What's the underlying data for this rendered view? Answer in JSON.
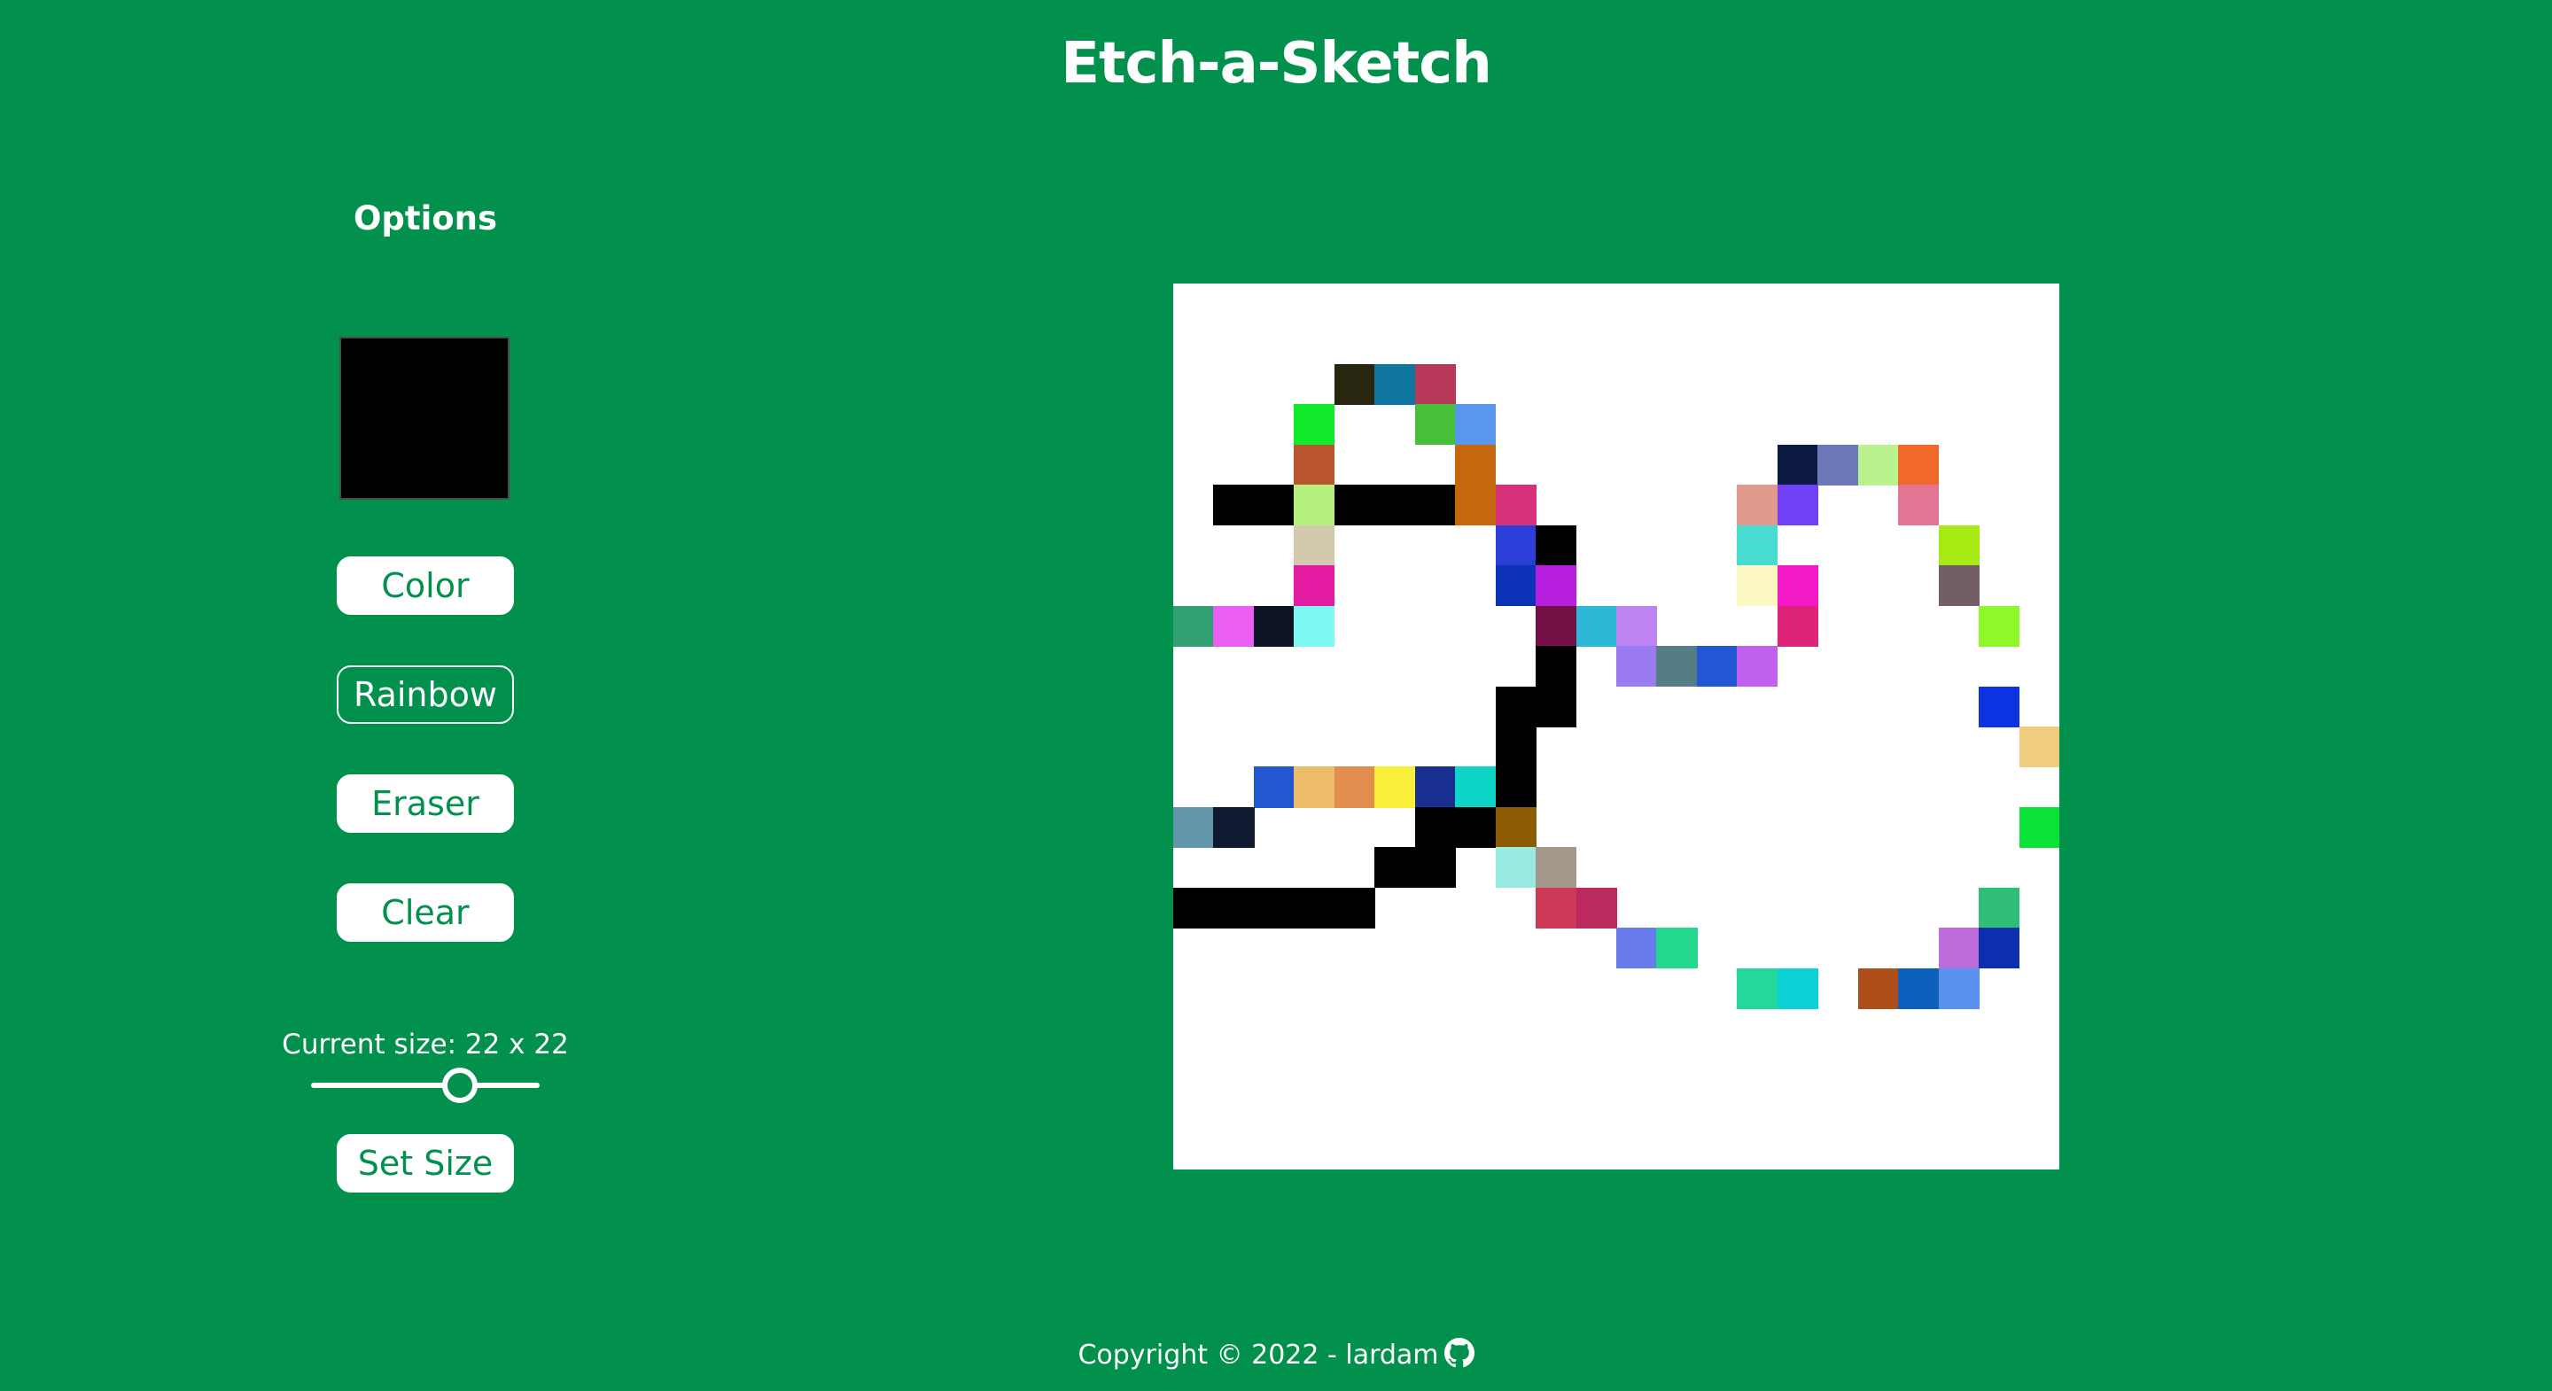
{
  "header": {
    "title": "Etch-a-Sketch"
  },
  "options": {
    "title": "Options",
    "current_color": "#000000",
    "buttons": {
      "color": "Color",
      "rainbow": "Rainbow",
      "eraser": "Eraser",
      "clear": "Clear",
      "set_size": "Set Size"
    },
    "active_mode": "rainbow",
    "size_label": "Current size: 22 x 22",
    "size": {
      "value": 22,
      "min": 1,
      "max": 32
    }
  },
  "grid": {
    "rows": 22,
    "cols": 22,
    "background": "#ffffff",
    "painted_cells": [
      [
        2,
        4,
        "#28260f"
      ],
      [
        2,
        5,
        "#0f779f"
      ],
      [
        2,
        6,
        "#b8385a"
      ],
      [
        3,
        3,
        "#10ea2b"
      ],
      [
        3,
        6,
        "#46c038"
      ],
      [
        3,
        7,
        "#5997ec"
      ],
      [
        4,
        3,
        "#b8552c"
      ],
      [
        4,
        7,
        "#c4670e"
      ],
      [
        4,
        15,
        "#0c1a42"
      ],
      [
        4,
        16,
        "#6d78b9"
      ],
      [
        4,
        17,
        "#b9f28e"
      ],
      [
        4,
        18,
        "#f1682b"
      ],
      [
        5,
        1,
        "#000000"
      ],
      [
        5,
        2,
        "#000000"
      ],
      [
        5,
        3,
        "#b5f07e"
      ],
      [
        5,
        4,
        "#000000"
      ],
      [
        5,
        5,
        "#000000"
      ],
      [
        5,
        6,
        "#000000"
      ],
      [
        5,
        7,
        "#c4670e"
      ],
      [
        5,
        8,
        "#d8317b"
      ],
      [
        5,
        14,
        "#e0998a"
      ],
      [
        5,
        15,
        "#7041f7"
      ],
      [
        5,
        18,
        "#e17593"
      ],
      [
        6,
        3,
        "#d3c9ad"
      ],
      [
        6,
        8,
        "#2b3ed8"
      ],
      [
        6,
        9,
        "#000000"
      ],
      [
        6,
        14,
        "#47dbd1"
      ],
      [
        6,
        19,
        "#a8ea14"
      ],
      [
        7,
        3,
        "#e21ba1"
      ],
      [
        7,
        8,
        "#0c32b7"
      ],
      [
        7,
        9,
        "#b81ede"
      ],
      [
        7,
        14,
        "#fbf8c4"
      ],
      [
        7,
        15,
        "#f419c7"
      ],
      [
        7,
        19,
        "#715e66"
      ],
      [
        8,
        0,
        "#31a173"
      ],
      [
        8,
        1,
        "#ea5ff1"
      ],
      [
        8,
        2,
        "#0c1425"
      ],
      [
        8,
        3,
        "#7ef8f2"
      ],
      [
        8,
        9,
        "#741046"
      ],
      [
        8,
        10,
        "#2db8d8"
      ],
      [
        8,
        11,
        "#bf83f1"
      ],
      [
        8,
        15,
        "#de2478"
      ],
      [
        8,
        20,
        "#8ef82a"
      ],
      [
        9,
        9,
        "#000000"
      ],
      [
        9,
        11,
        "#9a7bf1"
      ],
      [
        9,
        12,
        "#547d86"
      ],
      [
        9,
        13,
        "#2256d4"
      ],
      [
        9,
        14,
        "#c060ec"
      ],
      [
        10,
        8,
        "#000000"
      ],
      [
        10,
        9,
        "#000000"
      ],
      [
        10,
        20,
        "#0d33e3"
      ],
      [
        11,
        8,
        "#000000"
      ],
      [
        11,
        21,
        "#f0cc7e"
      ],
      [
        12,
        2,
        "#2257cf"
      ],
      [
        12,
        3,
        "#ecbc68"
      ],
      [
        12,
        4,
        "#e18d4e"
      ],
      [
        12,
        5,
        "#f9ee38"
      ],
      [
        12,
        6,
        "#192f8f"
      ],
      [
        12,
        7,
        "#0fd5c7"
      ],
      [
        12,
        8,
        "#000000"
      ],
      [
        13,
        0,
        "#6396aa"
      ],
      [
        13,
        1,
        "#0f1a31"
      ],
      [
        13,
        6,
        "#000000"
      ],
      [
        13,
        7,
        "#000000"
      ],
      [
        13,
        8,
        "#8c5c04"
      ],
      [
        13,
        21,
        "#09e337"
      ],
      [
        14,
        5,
        "#000000"
      ],
      [
        14,
        6,
        "#000000"
      ],
      [
        14,
        8,
        "#99ebe1"
      ],
      [
        14,
        9,
        "#a4978b"
      ],
      [
        15,
        0,
        "#000000"
      ],
      [
        15,
        1,
        "#000000"
      ],
      [
        15,
        2,
        "#000000"
      ],
      [
        15,
        3,
        "#000000"
      ],
      [
        15,
        4,
        "#000000"
      ],
      [
        15,
        9,
        "#ce3957"
      ],
      [
        15,
        10,
        "#bb2a5e"
      ],
      [
        15,
        20,
        "#2ebe78"
      ],
      [
        16,
        11,
        "#6a7ceb"
      ],
      [
        16,
        12,
        "#21d88d"
      ],
      [
        16,
        19,
        "#bc6cd8"
      ],
      [
        16,
        20,
        "#0c2fad"
      ],
      [
        17,
        14,
        "#24d79a"
      ],
      [
        17,
        15,
        "#0cd2d5"
      ],
      [
        17,
        17,
        "#ae4f19"
      ],
      [
        17,
        18,
        "#0d61bd"
      ],
      [
        17,
        19,
        "#5991ee"
      ]
    ]
  },
  "footer": {
    "text": "Copyright © 2022 - lardam",
    "icon": "github-icon"
  }
}
